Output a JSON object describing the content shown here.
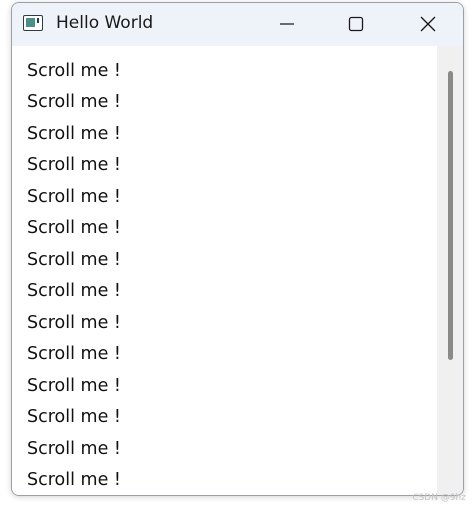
{
  "window": {
    "title": "Hello World",
    "icon": "app-window-icon"
  },
  "titlebar_buttons": {
    "minimize": "minimize-icon",
    "maximize": "maximize-icon",
    "close": "close-icon"
  },
  "content": {
    "lines": [
      "Scroll me !",
      "Scroll me !",
      "Scroll me !",
      "Scroll me !",
      "Scroll me !",
      "Scroll me !",
      "Scroll me !",
      "Scroll me !",
      "Scroll me !",
      "Scroll me !",
      "Scroll me !",
      "Scroll me !",
      "Scroll me !",
      "Scroll me !"
    ]
  },
  "watermark": "CSDN @9hz",
  "colors": {
    "titlebar": "#eef2f9",
    "scrollbar_track": "#f0f0f0",
    "scrollbar_thumb": "#8a8a8a"
  }
}
